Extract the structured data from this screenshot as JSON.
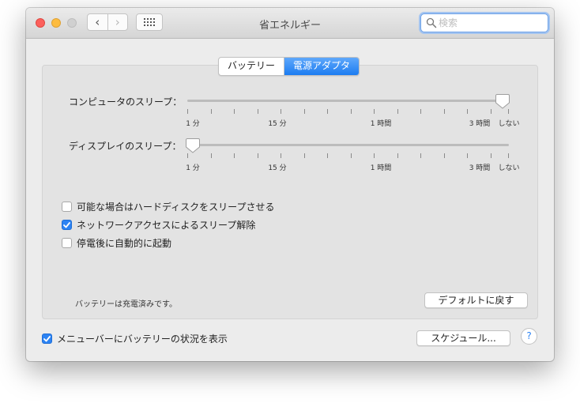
{
  "window": {
    "title": "省エネルギー"
  },
  "search": {
    "placeholder": "検索"
  },
  "tabs": [
    {
      "label": "バッテリー",
      "active": false
    },
    {
      "label": "電源アダプタ",
      "active": true
    }
  ],
  "sliders": [
    {
      "label": "コンピュータのスリープ：",
      "value_label": "しない",
      "tick_labels": [
        "1 分",
        "15 分",
        "1 時間",
        "3 時間",
        "しない"
      ]
    },
    {
      "label": "ディスプレイのスリープ：",
      "value_label": "1 分",
      "tick_labels": [
        "1 分",
        "15 分",
        "1 時間",
        "3 時間",
        "しない"
      ]
    }
  ],
  "options": [
    {
      "label": "可能な場合はハードディスクをスリープさせる",
      "checked": false
    },
    {
      "label": "ネットワークアクセスによるスリープ解除",
      "checked": true
    },
    {
      "label": "停電後に自動的に起動",
      "checked": false
    }
  ],
  "status_text": "バッテリーは充電済みです。",
  "buttons": {
    "defaults": "デフォルトに戻す",
    "schedule": "スケジュール...",
    "help": "?"
  },
  "menubar_option": {
    "label": "メニューバーにバッテリーの状況を表示",
    "checked": true
  },
  "colors": {
    "accent": "#2c83f3",
    "close": "#fc605c",
    "minimize": "#fdbc40"
  }
}
